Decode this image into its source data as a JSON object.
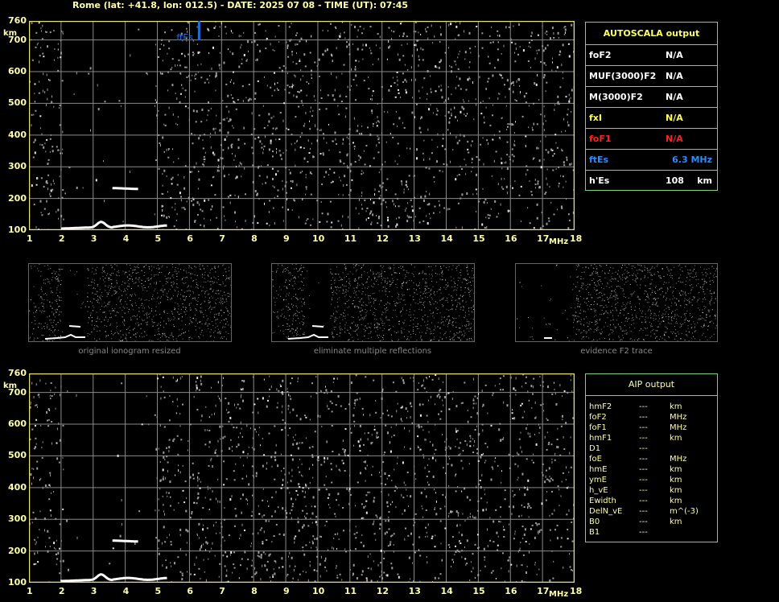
{
  "header": {
    "title": "Rome (lat: +41.8, lon: 012.5) - DATE: 2025 07 08 - TIME (UT): 07:45"
  },
  "axes": {
    "y_unit": "km",
    "x_unit": "MHz",
    "y_ticks": [
      "760",
      "700",
      "600",
      "500",
      "400",
      "300",
      "200",
      "100"
    ],
    "x_ticks": [
      "1",
      "2",
      "3",
      "4",
      "5",
      "6",
      "7",
      "8",
      "9",
      "10",
      "11",
      "12",
      "13",
      "14",
      "15",
      "16",
      "17",
      "18"
    ]
  },
  "ionogram": {
    "ftEs_marker_label": "ftEs",
    "ftEs_marker_mhz": 6.3,
    "colors": {
      "frame": "#e8e080",
      "grid": "#8a8a8a",
      "noise": "#c8c8c8",
      "trace": "#ffffff",
      "marker": "#1e6fe0"
    }
  },
  "autoscala": {
    "title": "AUTOSCALA output",
    "rows": [
      {
        "key": "foF2",
        "value": "N/A",
        "color": "#ffffff"
      },
      {
        "key": "MUF(3000)F2",
        "value": "N/A",
        "color": "#ffffff"
      },
      {
        "key": "M(3000)F2",
        "value": "N/A",
        "color": "#ffffff"
      },
      {
        "key": "fxI",
        "value": "N/A",
        "color": "#ffff44"
      },
      {
        "key": "foF1",
        "value": "N/A",
        "color": "#ff2020"
      },
      {
        "key": "ftEs",
        "value": "6.3 MHz",
        "color": "#2a8cff"
      },
      {
        "key": "h'Es",
        "value": "108",
        "unit": "km",
        "color": "#ffffff"
      }
    ]
  },
  "thumbnails": [
    {
      "caption": "original ionogram resized"
    },
    {
      "caption": "eliminate multiple reflections"
    },
    {
      "caption": "evidence F2 trace"
    }
  ],
  "aip": {
    "title": "AIP output",
    "rows": [
      {
        "key": "hmF2",
        "value": "---",
        "unit": "km"
      },
      {
        "key": "foF2",
        "value": "---",
        "unit": "MHz"
      },
      {
        "key": "foF1",
        "value": "---",
        "unit": "MHz"
      },
      {
        "key": "hmF1",
        "value": "---",
        "unit": "km"
      },
      {
        "key": "D1",
        "value": "---",
        "unit": ""
      },
      {
        "key": "foE",
        "value": "---",
        "unit": "MHz"
      },
      {
        "key": "hmE",
        "value": "---",
        "unit": "km"
      },
      {
        "key": "ymE",
        "value": "---",
        "unit": "km"
      },
      {
        "key": "h_vE",
        "value": "---",
        "unit": "km"
      },
      {
        "key": "Ewidth",
        "value": "---",
        "unit": "km"
      },
      {
        "key": "DelN_vE",
        "value": "---",
        "unit": "m^(-3)"
      },
      {
        "key": "B0",
        "value": "---",
        "unit": "km"
      },
      {
        "key": "B1",
        "value": "---",
        "unit": ""
      }
    ]
  }
}
